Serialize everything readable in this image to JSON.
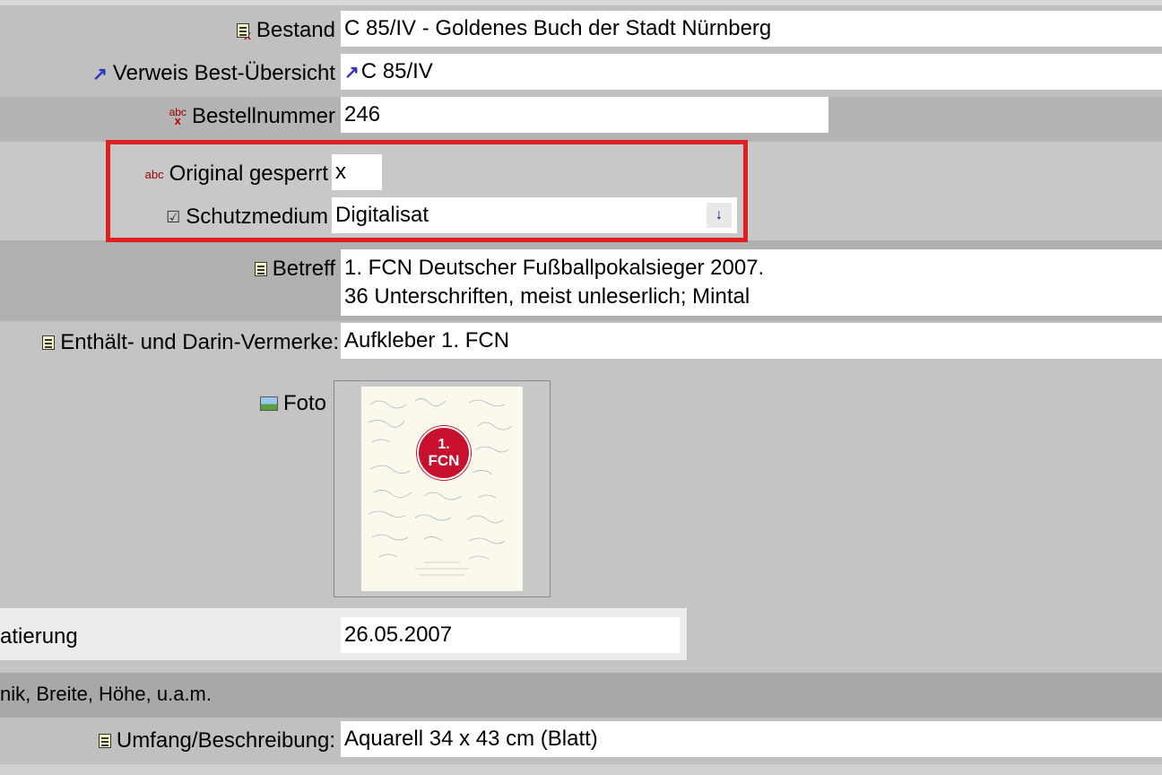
{
  "fields": {
    "bestand": {
      "label": "Bestand",
      "value": "C 85/IV - Goldenes Buch der Stadt Nürnberg"
    },
    "verweis": {
      "label": "Verweis Best-Übersicht",
      "value": "C 85/IV"
    },
    "bestellnummer": {
      "label": "Bestellnummer",
      "value": "246"
    },
    "original_gesperrt": {
      "label": "Original gesperrt",
      "value": "x"
    },
    "schutzmedium": {
      "label": "Schutzmedium",
      "value": "Digitalisat"
    },
    "betreff": {
      "label": "Betreff",
      "line1": "1. FCN Deutscher Fußballpokalsieger 2007.",
      "line2": "36 Unterschriften, meist unleserlich; Mintal"
    },
    "enthaelt": {
      "label": "Enthält- und Darin-Vermerke:",
      "value": "Aufkleber 1. FCN"
    },
    "foto": {
      "label": "Foto",
      "logo_text_top": "1.",
      "logo_text_bottom": "FCN"
    },
    "datierung": {
      "label": "atierung",
      "value": "26.05.2007"
    },
    "section": {
      "label": "nik, Breite, Höhe, u.a.m."
    },
    "umfang": {
      "label": "Umfang/Beschreibung:",
      "value": "Aquarell 34 x 43 cm (Blatt)"
    }
  },
  "icons": {
    "abc": "abc",
    "abcx": "abc",
    "dropdown_arrow": "↓",
    "link_arrow": "↗"
  },
  "colors": {
    "highlight_border": "#e02020",
    "logo_red": "#c8102e"
  }
}
